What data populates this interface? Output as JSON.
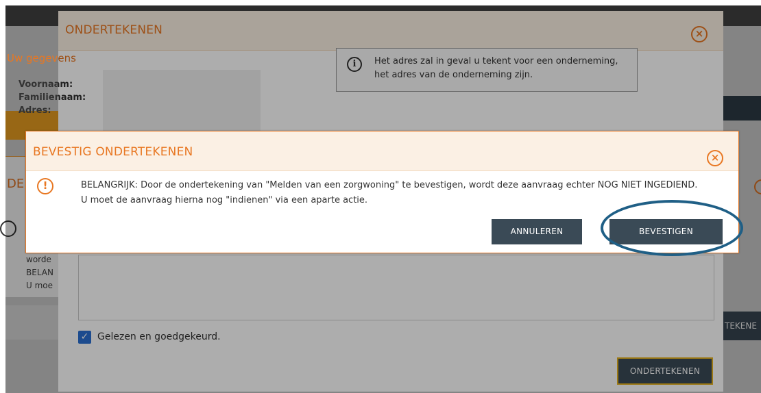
{
  "background": {
    "left_title": "DER",
    "left_text_lines": [
      "worde",
      "BELAN",
      "U moe"
    ],
    "right_button": "TEKENE"
  },
  "sign_modal": {
    "title": "ONDERTEKENEN",
    "close_icon": "close-circle-icon",
    "section_title": "Uw gegevens",
    "fields": [
      "Voornaam:",
      "Familienaam:",
      "Adres:"
    ],
    "info_icon": "info-circle-icon",
    "info_text": "Het adres zal in geval u tekent voor een onderneming, het adres van de onderneming zijn.",
    "checkbox_label": "Gelezen en goedgekeurd.",
    "checkbox_checked": true,
    "sign_button": "ONDERTEKENEN"
  },
  "confirm_dialog": {
    "title": "BEVESTIG ONDERTEKENEN",
    "close_icon": "close-circle-icon",
    "warning_icon": "warning-circle-icon",
    "message_line1": "BELANGRIJK: Door de ondertekening van \"Melden van een zorgwoning\" te bevestigen, wordt deze aanvraag echter NOG NIET INGEDIEND.",
    "message_line2": "U moet de aanvraag hierna nog \"indienen\" via een aparte actie.",
    "cancel_button": "ANNULEREN",
    "confirm_button": "BEVESTIGEN"
  },
  "colors": {
    "accent": "#e87722",
    "button": "#3a4a56",
    "highlight": "#1f5f86",
    "checkbox": "#2a6fd1"
  }
}
